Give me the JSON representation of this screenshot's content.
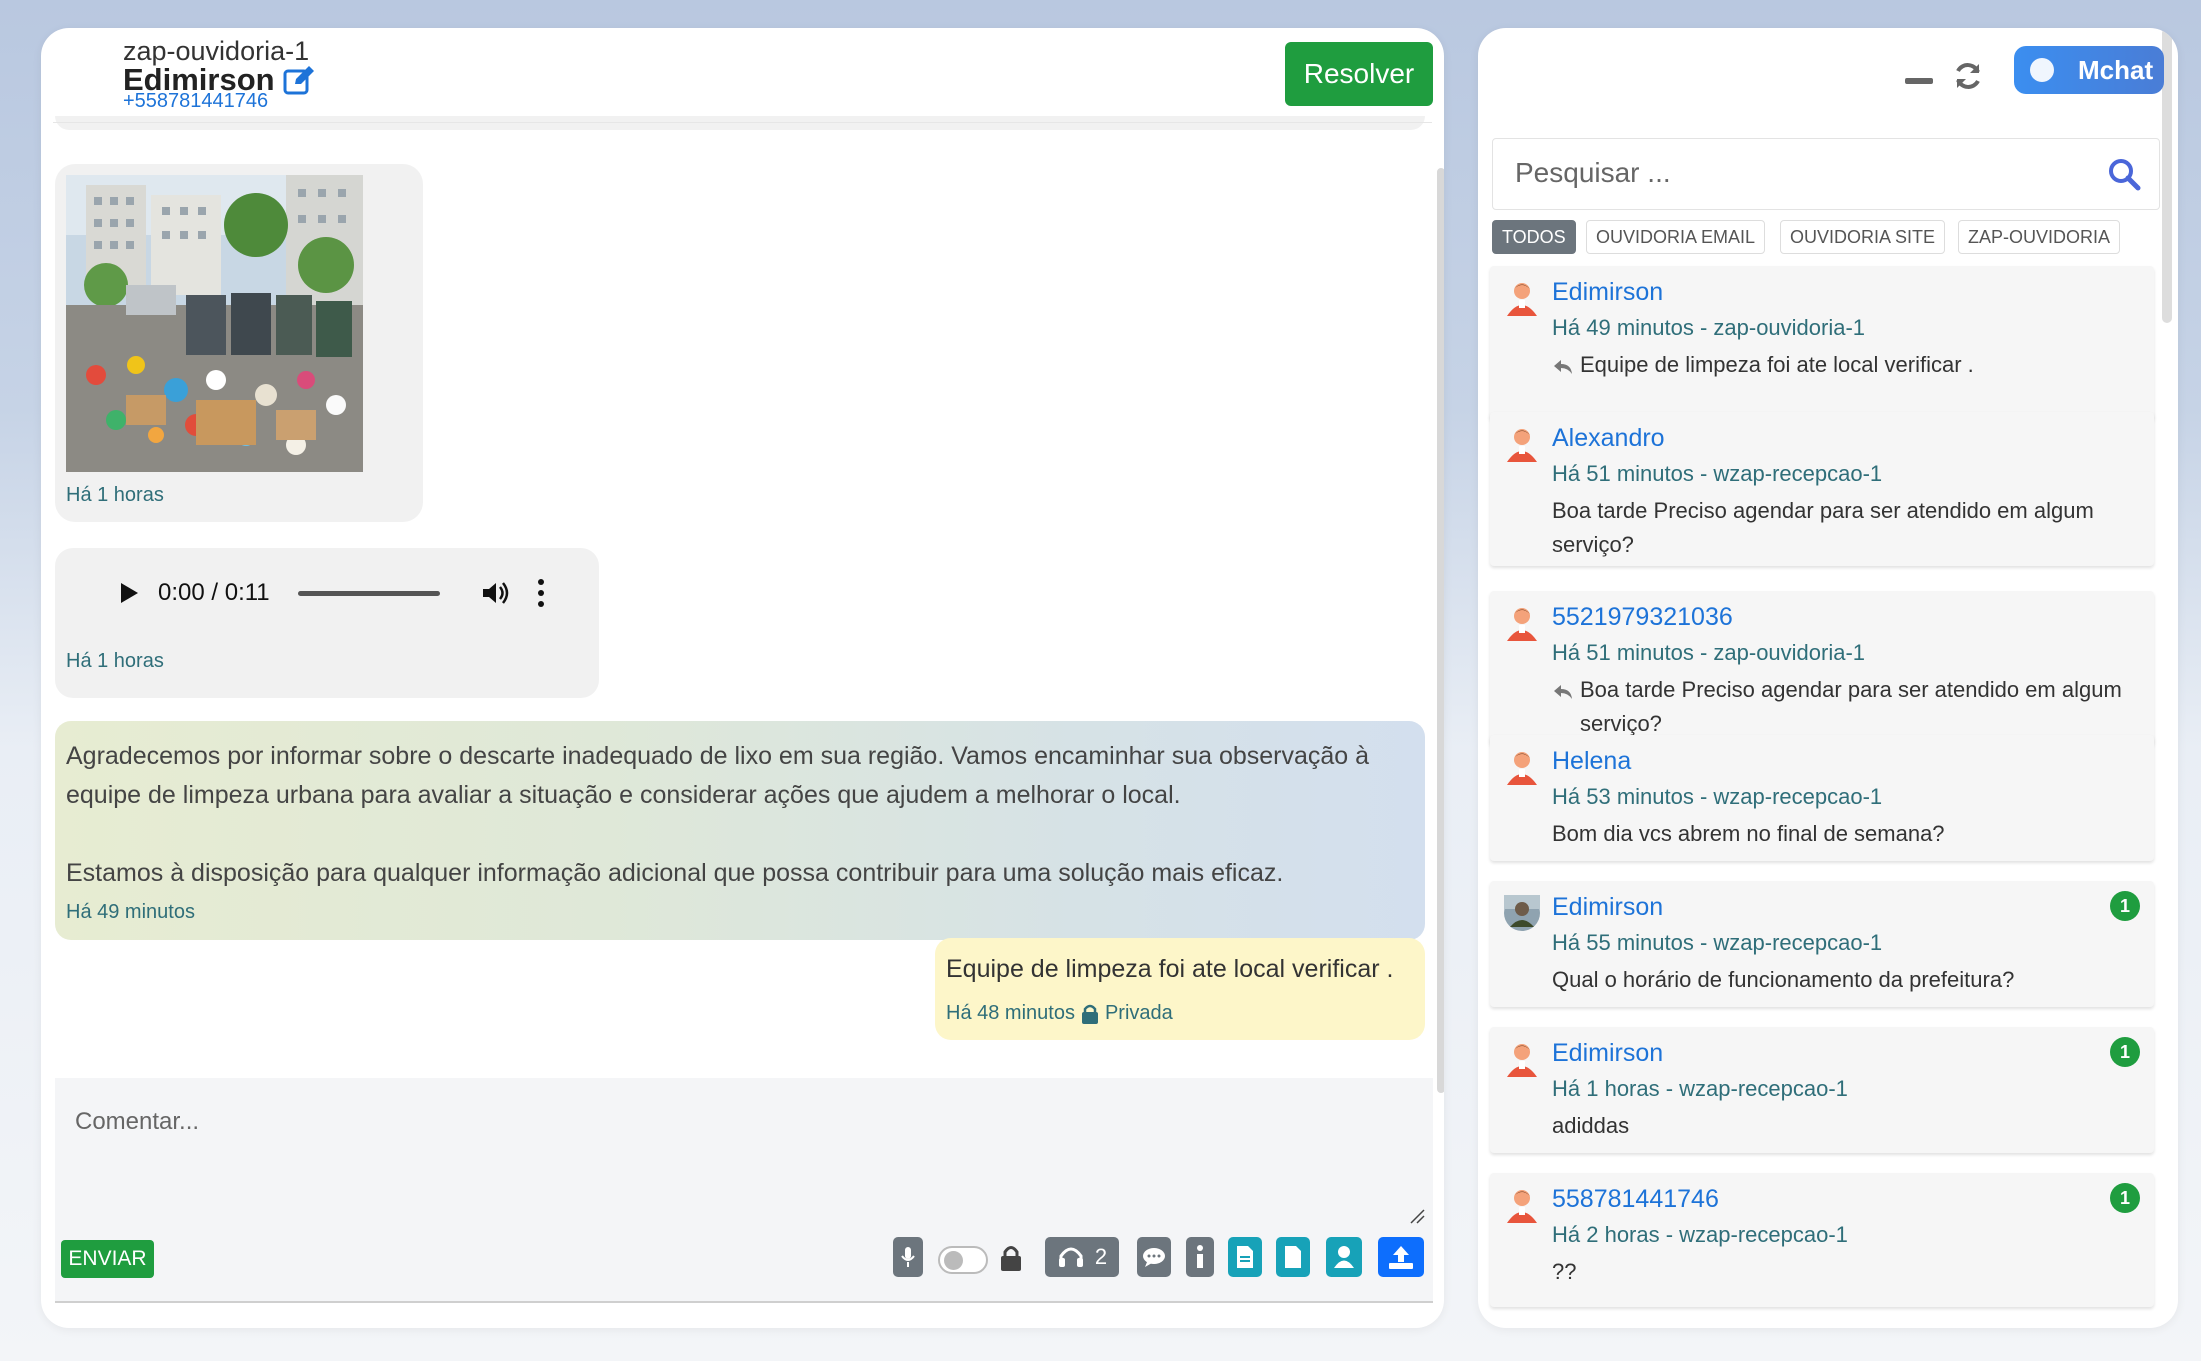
{
  "chat": {
    "channel": "zap-ouvidoria-1",
    "contact_name": "Edimirson",
    "contact_phone": "+558781441746",
    "resolve_label": "Resolver",
    "messages": [
      {
        "type": "image",
        "time": "Há 1 horas"
      },
      {
        "type": "audio",
        "current": "0:00",
        "duration": "0:11",
        "display": "0:00 / 0:11",
        "time": "Há 1 horas"
      },
      {
        "type": "text",
        "paragraph1": "Agradecemos por informar sobre o descarte inadequado de lixo em sua região. Vamos encaminhar sua observação à equipe de limpeza urbana para avaliar a situação e considerar ações que ajudem a melhorar o local.",
        "paragraph2": "Estamos à disposição para qualquer informação adicional que possa contribuir para uma solução mais eficaz.",
        "time": "Há 49 minutos"
      },
      {
        "type": "note",
        "text": "Equipe de limpeza foi ate local verificar .",
        "time": "Há 48 minutos",
        "privacy": "Privada"
      }
    ],
    "composer": {
      "placeholder": "Comentar...",
      "send_label": "ENVIAR",
      "agents_count": "2",
      "tools": [
        "microphone-icon",
        "toggle",
        "lock-icon",
        "headset-icon",
        "chat-icon",
        "info-icon",
        "document-icon",
        "file-icon",
        "user-icon",
        "upload-icon"
      ]
    }
  },
  "sidebar": {
    "brand_label": "Mchat",
    "search_placeholder": "Pesquisar ...",
    "filters": [
      "TODOS",
      "OUVIDORIA EMAIL",
      "OUVIDORIA SITE",
      "ZAP-OUVIDORIA"
    ],
    "active_filter": "TODOS",
    "conversations": [
      {
        "name": "Edimirson",
        "meta": "Há 49 minutos - zap-ouvidoria-1",
        "msg": "Equipe de limpeza foi ate local verificar .",
        "reply": true,
        "badge": "",
        "avatar": "person"
      },
      {
        "name": "Alexandro",
        "meta": "Há 51 minutos - wzap-recepcao-1",
        "msg": "Boa tarde Preciso agendar para ser atendido em algum serviço?",
        "reply": false,
        "badge": "",
        "avatar": "person"
      },
      {
        "name": "5521979321036",
        "meta": "Há 51 minutos - zap-ouvidoria-1",
        "msg": "Boa tarde Preciso agendar para ser atendido em algum serviço?",
        "reply": true,
        "badge": "",
        "avatar": "person"
      },
      {
        "name": "Helena",
        "meta": "Há 53 minutos - wzap-recepcao-1",
        "msg": "Bom dia vcs abrem no final de semana?",
        "reply": false,
        "badge": "",
        "avatar": "person"
      },
      {
        "name": "Edimirson",
        "meta": "Há 55 minutos - wzap-recepcao-1",
        "msg": "Qual o horário de funcionamento da prefeitura?",
        "reply": false,
        "badge": "1",
        "avatar": "photo"
      },
      {
        "name": "Edimirson",
        "meta": "Há 1 horas - wzap-recepcao-1",
        "msg": "adiddas",
        "reply": false,
        "badge": "1",
        "avatar": "person"
      },
      {
        "name": "558781441746",
        "meta": "Há 2 horas - wzap-recepcao-1",
        "msg": "??",
        "reply": false,
        "badge": "1",
        "avatar": "person"
      }
    ]
  },
  "colors": {
    "accent_green": "#1f9d3f",
    "link_blue": "#1d73d8",
    "time_teal": "#2f6e79",
    "note_yellow": "#fdf6c9"
  }
}
